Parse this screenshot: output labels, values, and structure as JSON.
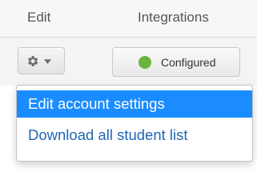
{
  "header": {
    "col_edit": "Edit",
    "col_integrations": "Integrations"
  },
  "row": {
    "gear_button_icon": "gear-icon",
    "caret_icon": "chevron-down-icon",
    "integration_status": "Configured",
    "status_color": "#6cb33f"
  },
  "menu": {
    "items": [
      {
        "label": "Edit account settings",
        "highlighted": true
      },
      {
        "label": "Download all student list",
        "highlighted": false
      }
    ],
    "highlight_color": "#1a8cff",
    "link_color": "#1f66b3"
  }
}
